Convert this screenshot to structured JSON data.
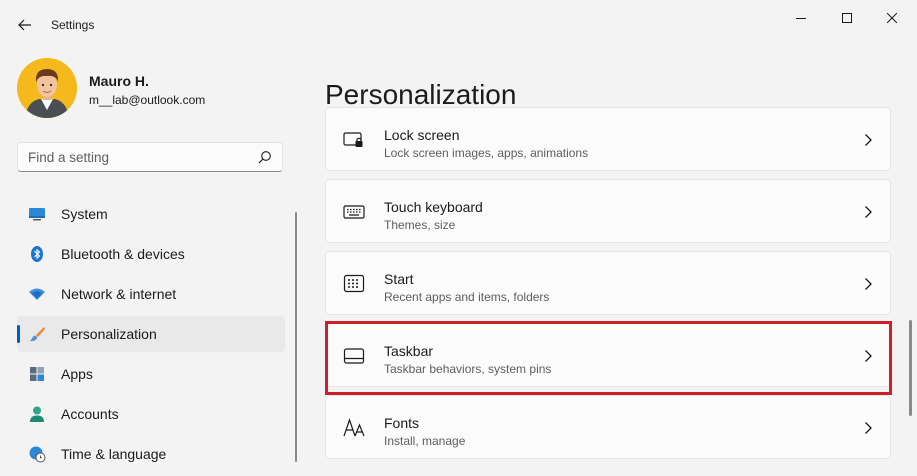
{
  "window": {
    "title": "Settings",
    "controls": [
      "minimize",
      "maximize",
      "close"
    ]
  },
  "profile": {
    "name": "Mauro H.",
    "email": "m__lab@outlook.com"
  },
  "search": {
    "placeholder": "Find a setting"
  },
  "sidebar": {
    "items": [
      {
        "label": "System",
        "icon": "monitor-icon"
      },
      {
        "label": "Bluetooth & devices",
        "icon": "bluetooth-icon"
      },
      {
        "label": "Network & internet",
        "icon": "wifi-icon"
      },
      {
        "label": "Personalization",
        "icon": "brush-icon",
        "selected": true
      },
      {
        "label": "Apps",
        "icon": "apps-icon"
      },
      {
        "label": "Accounts",
        "icon": "person-icon"
      },
      {
        "label": "Time & language",
        "icon": "globe-clock-icon"
      }
    ]
  },
  "main": {
    "title": "Personalization",
    "cards": [
      {
        "title": "Lock screen",
        "subtitle": "Lock screen images, apps, animations",
        "icon": "lock-screen-icon"
      },
      {
        "title": "Touch keyboard",
        "subtitle": "Themes, size",
        "icon": "keyboard-icon"
      },
      {
        "title": "Start",
        "subtitle": "Recent apps and items, folders",
        "icon": "start-icon"
      },
      {
        "title": "Taskbar",
        "subtitle": "Taskbar behaviors, system pins",
        "icon": "taskbar-icon",
        "highlighted": true
      },
      {
        "title": "Fonts",
        "subtitle": "Install, manage",
        "icon": "fonts-icon"
      }
    ]
  },
  "colors": {
    "accent": "#005fb8",
    "highlight": "#cc1f2a"
  }
}
